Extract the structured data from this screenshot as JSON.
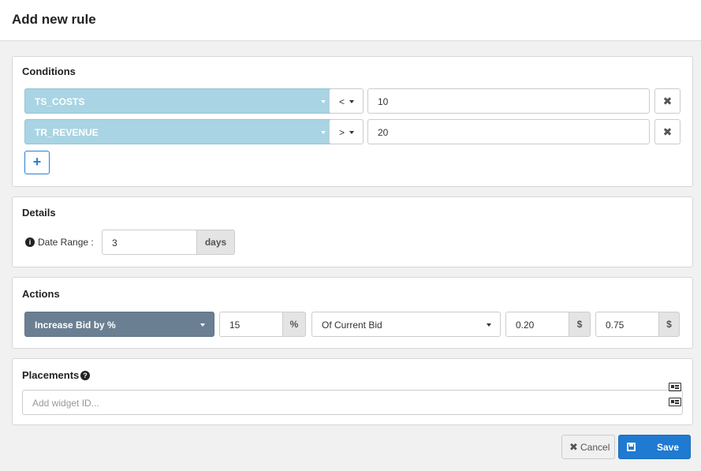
{
  "header": {
    "title": "Add new rule"
  },
  "conditions": {
    "title": "Conditions",
    "rows": [
      {
        "field": "TS_COSTS",
        "operator": "<",
        "value": "10"
      },
      {
        "field": "TR_REVENUE",
        "operator": ">",
        "value": "20"
      }
    ],
    "add_label": "+",
    "remove_label": "✖"
  },
  "details": {
    "title": "Details",
    "date_range_label": "Date Range :",
    "date_range_value": "3",
    "date_range_unit": "days"
  },
  "actions": {
    "title": "Actions",
    "action": "Increase Bid by %",
    "percent_value": "15",
    "percent_unit": "%",
    "basis": "Of Current Bid",
    "min_value": "0.20",
    "min_unit": "$",
    "max_value": "0.75",
    "max_unit": "$"
  },
  "placements": {
    "title": "Placements",
    "placeholder": "Add widget ID..."
  },
  "footer": {
    "cancel_label": "Cancel",
    "save_label": "Save"
  },
  "colors": {
    "field_select": "#a9d4e3",
    "action_select": "#6b7f92",
    "primary": "#1f7ad1"
  }
}
